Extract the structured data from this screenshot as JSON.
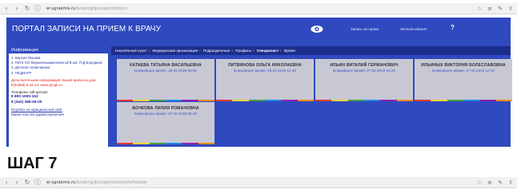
{
  "browser_top": {
    "url_host": "er.ugrakmis.ru",
    "url_path": "/booking/lpu/spec/doctors"
  },
  "browser_bottom": {
    "url_host": "er.ugrakmis.ru",
    "url_path": "/booking/lpu/spec/doctors/schedule"
  },
  "header": {
    "title": "ПОРТАЛ ЗАПИСИ НА ПРИЕМ К ВРАЧУ",
    "link1": "Запись на прием",
    "link2": "Личный кабинет",
    "help": "?"
  },
  "sidebar": {
    "title": "Информация",
    "items": [
      "1. Версия Пышма",
      "2. ГБУЗ СО 'Верхнепышминская ЦГБ им. П.Д Бородина'",
      "3. Детская поликлиника",
      "4. ПЕДИАТР"
    ],
    "extra_info": "Дополнительная информация: Вызов врача на дом: 8(34368) 5-44-44. www.vpcgb.ru",
    "phones_label": "Телефоны call-центра:",
    "phone1": "8 800 1000-153",
    "phone2": "8 (343) 385-06-00",
    "site_link": "Перейти на официальный сайт",
    "site_link2": "Министерства здравоохранения"
  },
  "breadcrumb": {
    "items": [
      "Населённый пункт",
      "Медицинская организация",
      "Подразделение",
      "Профиль"
    ],
    "current": "Специалист",
    "last": "Время"
  },
  "doctors": [
    {
      "name": "КАТАЕВА ТАТЬЯНА ВАСИЛЬЕВНА",
      "time": "Ближайшее время: 28.02.2018 09:30"
    },
    {
      "name": "ЛИТВИНОВА ОЛЬГА НИКОЛАЕВНА",
      "time": "Ближайшее время: 26.02.2018 12:45"
    },
    {
      "name": "ИЛЬИН ВИТАЛИЙ ГЕРМАНОВИЧ",
      "time": "Ближайшее время: 27.02.2018 16:20"
    },
    {
      "name": "ИЛЬИНЫХ ВИКТОРИЯ БОЛЕСЛАВОВНА",
      "time": "Ближайшее время: 27.02.2018 12:10"
    },
    {
      "name": "БОЧКОВА ЛИЛИЯ РОМАНОВНА",
      "time": "Ближайшее время: 27.02.2018 09:40"
    }
  ],
  "stripe_colors": [
    "#e53935",
    "#fdd835",
    "#43a047",
    "#1e88e5",
    "#8e24aa",
    "#fb8c00"
  ],
  "step_title": "ШАГ 7"
}
